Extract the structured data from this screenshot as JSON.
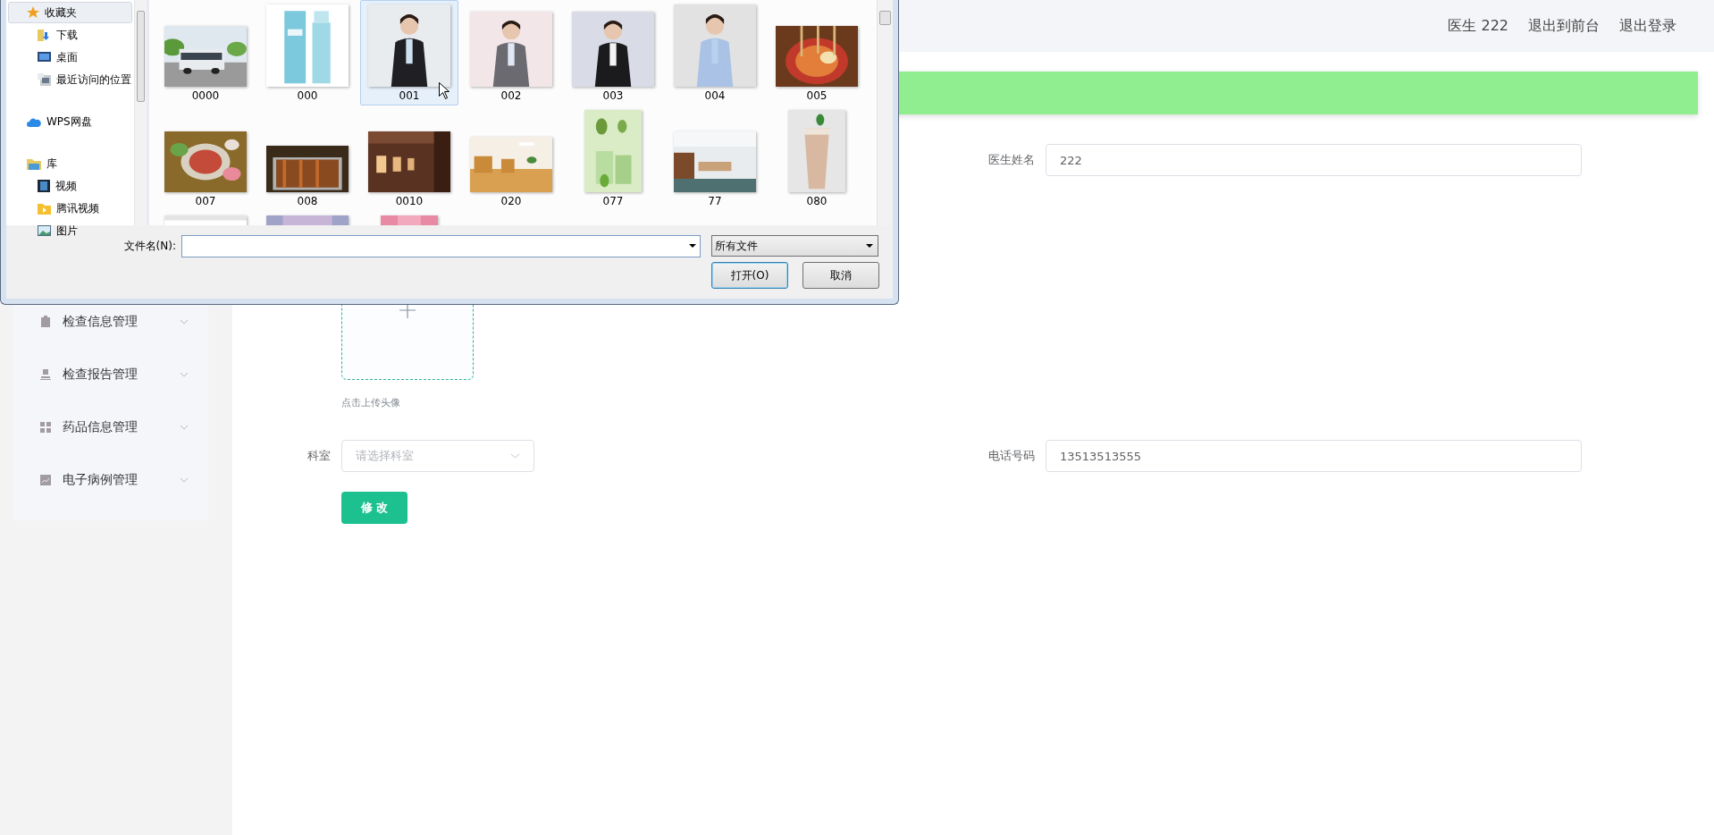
{
  "dialog": {
    "nav": [
      {
        "label": "收藏夹",
        "selected": true,
        "children": [
          {
            "label": "下载",
            "selected": false
          },
          {
            "label": "桌面",
            "selected": false
          },
          {
            "label": "最近访问的位置",
            "selected": false
          }
        ]
      },
      {
        "label": "WPS网盘",
        "selected": false
      },
      {
        "label": "库",
        "selected": false,
        "children": [
          {
            "label": "视频",
            "selected": false
          },
          {
            "label": "腾讯视频",
            "selected": false
          },
          {
            "label": "图片",
            "selected": false
          }
        ]
      }
    ],
    "files": [
      {
        "label": "0000",
        "selected": false,
        "kind": "picture"
      },
      {
        "label": "000",
        "selected": false,
        "kind": "picture"
      },
      {
        "label": "001",
        "selected": true,
        "kind": "picture"
      },
      {
        "label": "002",
        "selected": false,
        "kind": "picture"
      },
      {
        "label": "003",
        "selected": false,
        "kind": "picture"
      },
      {
        "label": "004",
        "selected": false,
        "kind": "picture"
      },
      {
        "label": "005",
        "selected": false,
        "kind": "picture"
      },
      {
        "label": "007",
        "selected": false,
        "kind": "picture"
      },
      {
        "label": "008",
        "selected": false,
        "kind": "picture"
      },
      {
        "label": "0010",
        "selected": false,
        "kind": "picture"
      },
      {
        "label": "020",
        "selected": false,
        "kind": "picture"
      },
      {
        "label": "077",
        "selected": false,
        "kind": "picture"
      },
      {
        "label": "77",
        "selected": false,
        "kind": "picture"
      },
      {
        "label": "080",
        "selected": false,
        "kind": "picture"
      },
      {
        "selected": false,
        "kind": "picture"
      },
      {
        "selected": false,
        "kind": "picture"
      },
      {
        "selected": false,
        "kind": "picture"
      }
    ],
    "filename_label": "文件名(N):",
    "filter": "所有文件",
    "buttons": [
      "打开(O)",
      "取消"
    ]
  },
  "header": {
    "user": "医生 222",
    "links": [
      "退出到前台",
      "退出登录"
    ]
  },
  "sidebar": {
    "items": [
      {
        "label": "检查信息管理",
        "expanded": false
      },
      {
        "label": "检查报告管理",
        "expanded": false
      },
      {
        "label": "药品信息管理",
        "expanded": false
      },
      {
        "label": "电子病例管理",
        "expanded": false
      }
    ]
  },
  "form": {
    "fields": [
      {
        "label": "医生姓名",
        "value": "222",
        "kind": "text"
      },
      {
        "label": "科室",
        "placeholder": "请选择科室",
        "kind": "select"
      },
      {
        "label": "电话号码",
        "value": "13513513555",
        "kind": "text"
      }
    ],
    "upload_hint": "点击上传头像",
    "submit": "修 改"
  }
}
